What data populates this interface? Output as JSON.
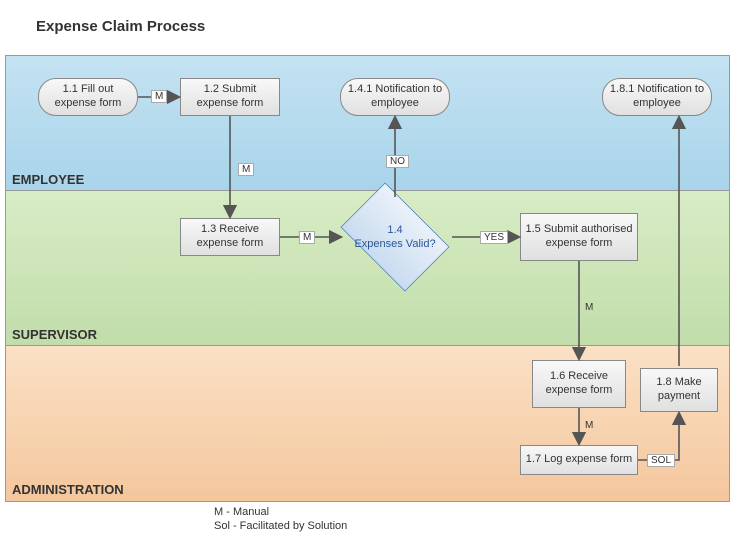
{
  "title": "Expense Claim Process",
  "lanes": {
    "employee": "EMPLOYEE",
    "supervisor": "SUPERVISOR",
    "admin": "ADMINISTRATION"
  },
  "nodes": {
    "n11": "1.1 Fill out expense form",
    "n12": "1.2 Submit expense form",
    "n13": "1.3 Receive expense form",
    "n141": "1.4.1 Notification to employee",
    "n14_num": "1.4",
    "n14_text": "Expenses  Valid?",
    "n15": "1.5 Submit authorised expense form",
    "n16": "1.6 Receive expense form",
    "n17": "1.7 Log expense form",
    "n18": "1.8 Make payment",
    "n181": "1.8.1 Notification to employee"
  },
  "labels": {
    "m": "M",
    "no": "NO",
    "yes": "YES",
    "sol": "SOL"
  },
  "legend": {
    "l1": "M - Manual",
    "l2": "Sol - Facilitated by Solution"
  }
}
